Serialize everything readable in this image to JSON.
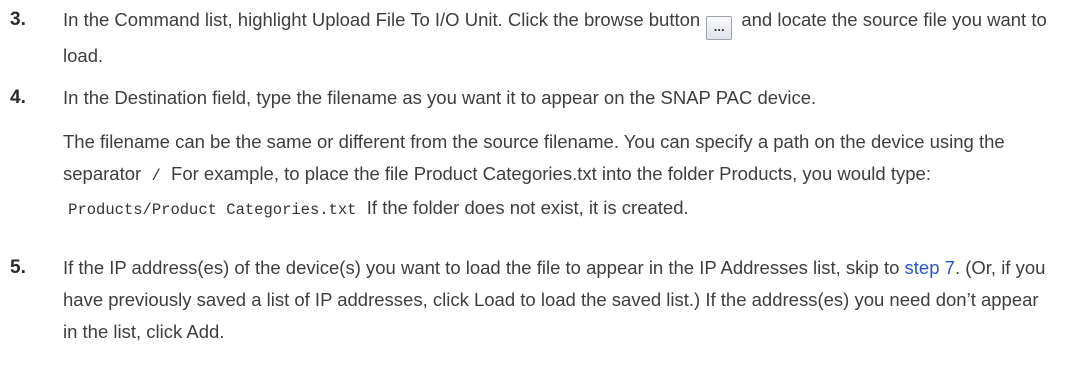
{
  "steps": [
    {
      "number": "3.",
      "text_a": "In the Command list, highlight Upload File To I/O Unit. Click the browse button",
      "browse_label": "...",
      "text_b": "and locate the source file you want to load."
    },
    {
      "number": "4.",
      "text": "In the Destination field, type the filename as you want it to appear on the SNAP PAC device.",
      "note_a": "The filename can be the same or different from the source filename. You can specify a path on the device using the separator",
      "separator": "/",
      "note_b": "For example, to place the file Product Categories.txt into the folder Products, you would type:",
      "example_path": "Products/Product Categories.txt",
      "note_c": "If the folder does not exist, it is created."
    },
    {
      "number": "5.",
      "text_a": "If the IP address(es) of the device(s) you want to load the file to appear in the IP Addresses list, skip to",
      "link": "step 7",
      "text_b": ". (Or, if you have previously saved a list of IP addresses, click Load to load the saved list.) If the address(es) you need don’t appear in the list, click Add."
    }
  ]
}
